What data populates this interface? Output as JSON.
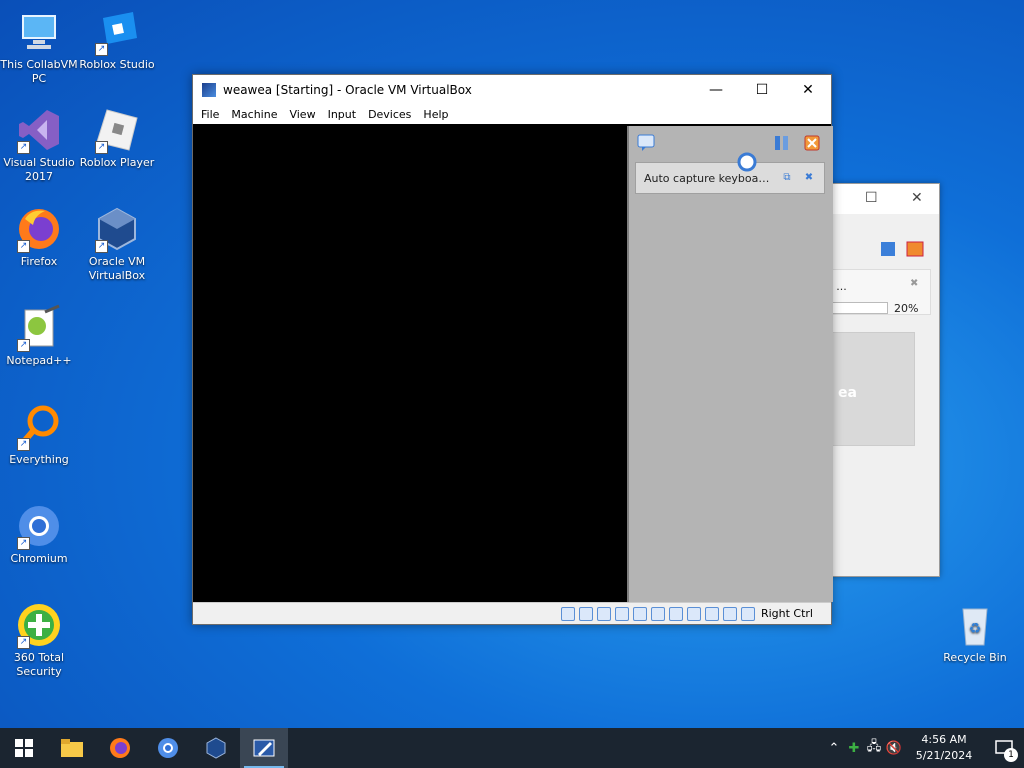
{
  "desktop": {
    "icons": [
      {
        "label": "This CollabVM PC"
      },
      {
        "label": "Roblox Studio"
      },
      {
        "label": "Visual Studio 2017"
      },
      {
        "label": "Roblox Player"
      },
      {
        "label": "Firefox"
      },
      {
        "label": "Oracle VM VirtualBox"
      },
      {
        "label": "Notepad++"
      },
      {
        "label": "Everything"
      },
      {
        "label": "Chromium"
      },
      {
        "label": "360 Total Security"
      },
      {
        "label": "Recycle Bin"
      }
    ]
  },
  "bg_window": {
    "progress_text": "o ...",
    "progress_percent": "20%",
    "preview_label": "ea"
  },
  "vm_window": {
    "title": "weawea [Starting] - Oracle VM VirtualBox",
    "menu": [
      "File",
      "Machine",
      "View",
      "Input",
      "Devices",
      "Help"
    ],
    "notification": "Auto capture keyboard ...",
    "host_key": "Right Ctrl"
  },
  "taskbar": {
    "time": "4:56 AM",
    "date": "5/21/2024",
    "notification_count": "1"
  }
}
